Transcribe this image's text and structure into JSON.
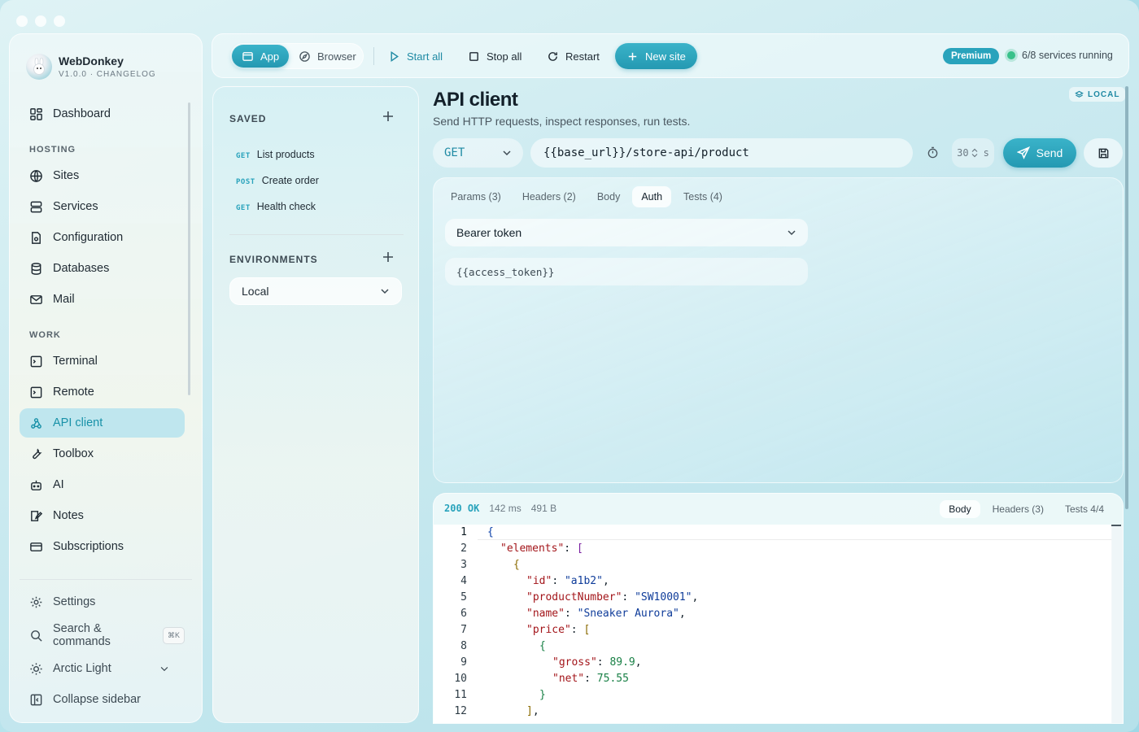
{
  "app": {
    "name": "WebDonkey",
    "version_line": "V1.0.0 · CHANGELOG"
  },
  "sidebar": {
    "dashboard": "Dashboard",
    "section_hosting": "HOSTING",
    "hosting_items": [
      "Sites",
      "Services",
      "Configuration",
      "Databases",
      "Mail"
    ],
    "section_work": "WORK",
    "work_items": [
      "Terminal",
      "Remote",
      "API client",
      "Toolbox",
      "AI",
      "Notes",
      "Subscriptions"
    ],
    "active_item": "API client",
    "settings": "Settings",
    "search": "Search & commands",
    "search_shortcut": "⌘K",
    "theme": "Arctic Light",
    "collapse": "Collapse sidebar"
  },
  "toolbar": {
    "mode_app": "App",
    "mode_browser": "Browser",
    "active_mode": "App",
    "start_all": "Start all",
    "stop_all": "Stop all",
    "restart": "Restart",
    "new_site": "New site",
    "plan_badge": "Premium",
    "services_status": "6/8 services running"
  },
  "saved": {
    "title": "SAVED",
    "requests": [
      {
        "method": "GET",
        "name": "List products"
      },
      {
        "method": "POST",
        "name": "Create order"
      },
      {
        "method": "GET",
        "name": "Health check"
      }
    ],
    "env_title": "ENVIRONMENTS",
    "env_selected": "Local"
  },
  "main": {
    "title": "API client",
    "subtitle": "Send HTTP requests, inspect responses, run tests.",
    "env_badge": "LOCAL",
    "method": "GET",
    "url": "{{base_url}}/store-api/product",
    "timeout_value": "30",
    "timeout_unit": "s",
    "send": "Send",
    "tabs": [
      "Params (3)",
      "Headers (2)",
      "Body",
      "Auth",
      "Tests (4)"
    ],
    "active_tab": "Auth",
    "auth_type": "Bearer token",
    "auth_token": "{{access_token}}"
  },
  "response": {
    "status": "200 OK",
    "time": "142 ms",
    "size": "491 B",
    "tabs": [
      "Body",
      "Headers (3)",
      "Tests 4/4"
    ],
    "active_tab": "Body",
    "line_numbers": [
      "1",
      "2",
      "3",
      "4",
      "5",
      "6",
      "7",
      "8",
      "9",
      "10",
      "11",
      "12"
    ],
    "lines": [
      "{",
      "\"elements\": [",
      "{",
      "\"id\": \"a1b2\",",
      "\"productNumber\": \"SW10001\",",
      "\"name\": \"Sneaker Aurora\",",
      "\"price\": [",
      "{",
      "\"gross\": 89.9,",
      "\"net\": 75.55",
      "}",
      "],"
    ]
  },
  "colors": {
    "accent": "#29a3bc",
    "accent_dark": "#1f8aa4",
    "running_dot": "#38c18a"
  }
}
